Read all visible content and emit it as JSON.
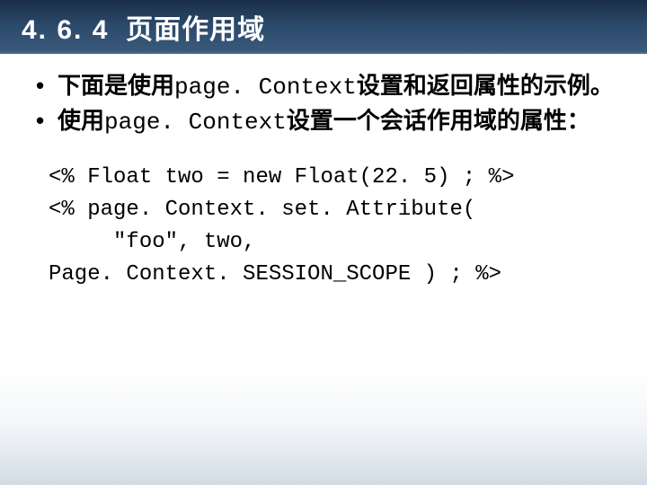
{
  "header": {
    "number": "4. 6. 4",
    "title": "页面作用域"
  },
  "bullets": [
    {
      "pre": "下面是使用",
      "mono": "page. Context",
      "post": "设置和返回属性的示例。"
    },
    {
      "pre": "使用",
      "mono": "page. Context",
      "post": "设置一个会话作用域的属性："
    }
  ],
  "code": {
    "line1": "<% Float two = new Float(22. 5) ; %>",
    "line2": "<% page. Context. set. Attribute(",
    "line3": "     \"foo\", two,",
    "line4": "Page. Context. SESSION_SCOPE ) ; %>"
  }
}
